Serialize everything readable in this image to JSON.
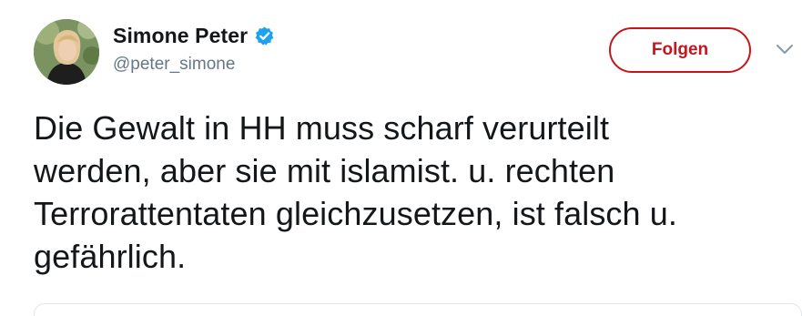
{
  "user": {
    "display_name": "Simone Peter",
    "handle": "@peter_simone",
    "verified": true,
    "avatar_icon": "profile-photo"
  },
  "actions": {
    "follow_label": "Folgen",
    "more_icon": "chevron-down-icon"
  },
  "tweet": {
    "lines": [
      "Die Gewalt in HH muss scharf verurteilt",
      "werden, aber sie mit islamist. u. rechten",
      "Terrorattentaten gleichzusetzen, ist falsch u.",
      "gefährlich."
    ]
  },
  "colors": {
    "follow_accent": "#c4161c",
    "verified_badge": "#1da1f2",
    "handle_gray": "#657786",
    "text": "#14171a"
  }
}
